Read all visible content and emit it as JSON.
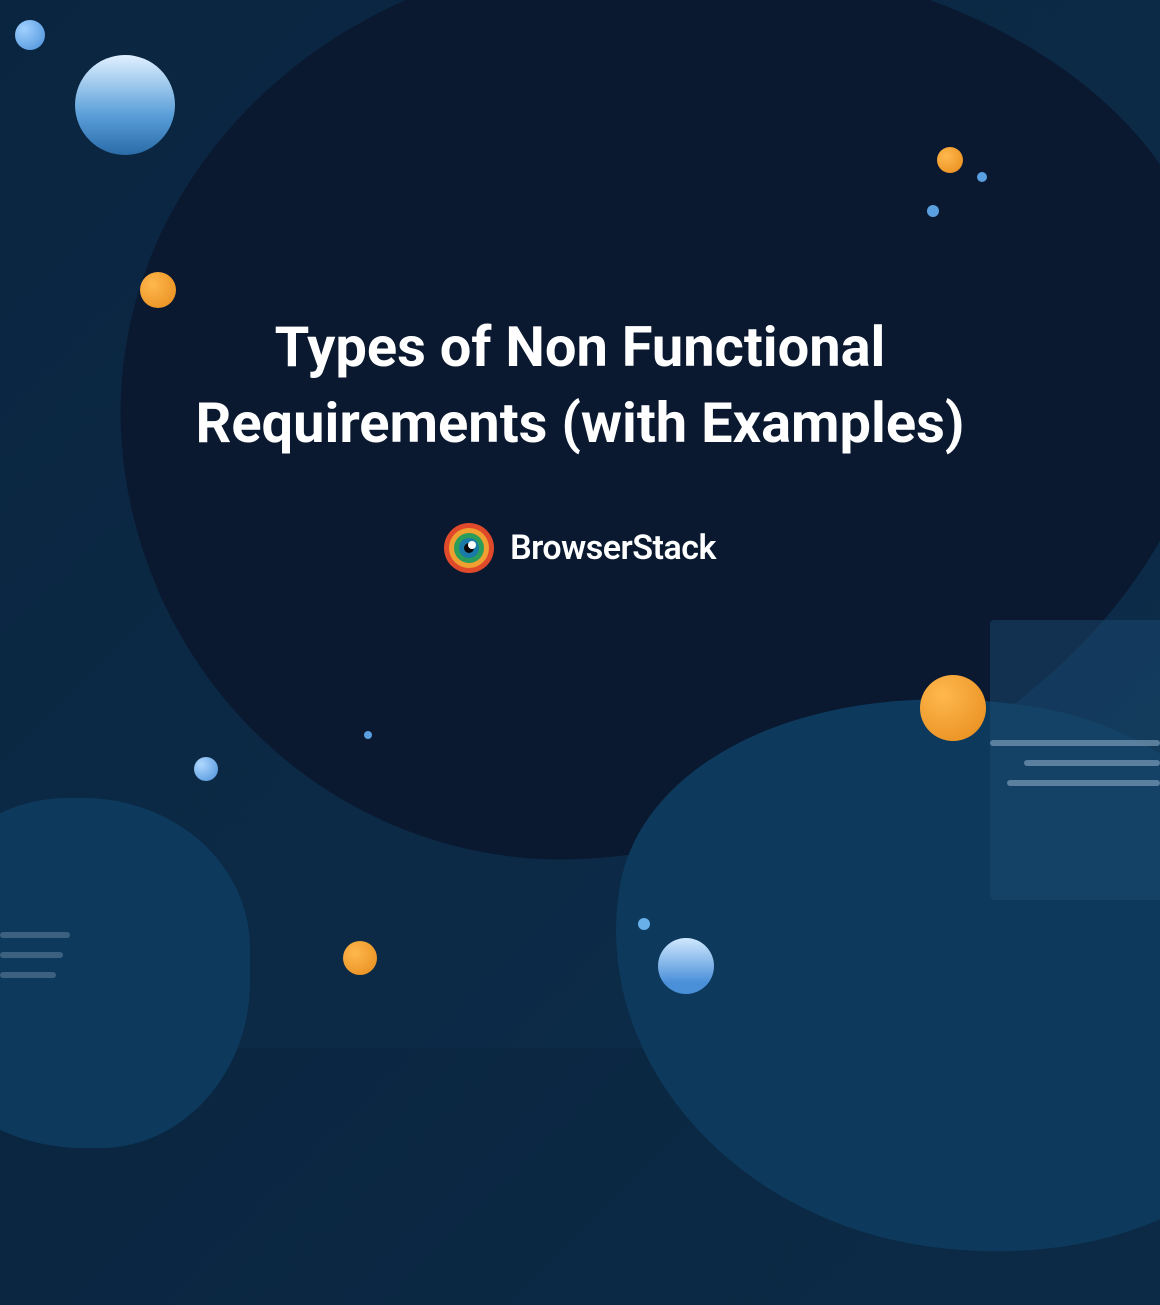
{
  "hero": {
    "title": "Types of Non Functional Requirements (with Examples)"
  },
  "brand": {
    "name": "BrowserStack"
  }
}
